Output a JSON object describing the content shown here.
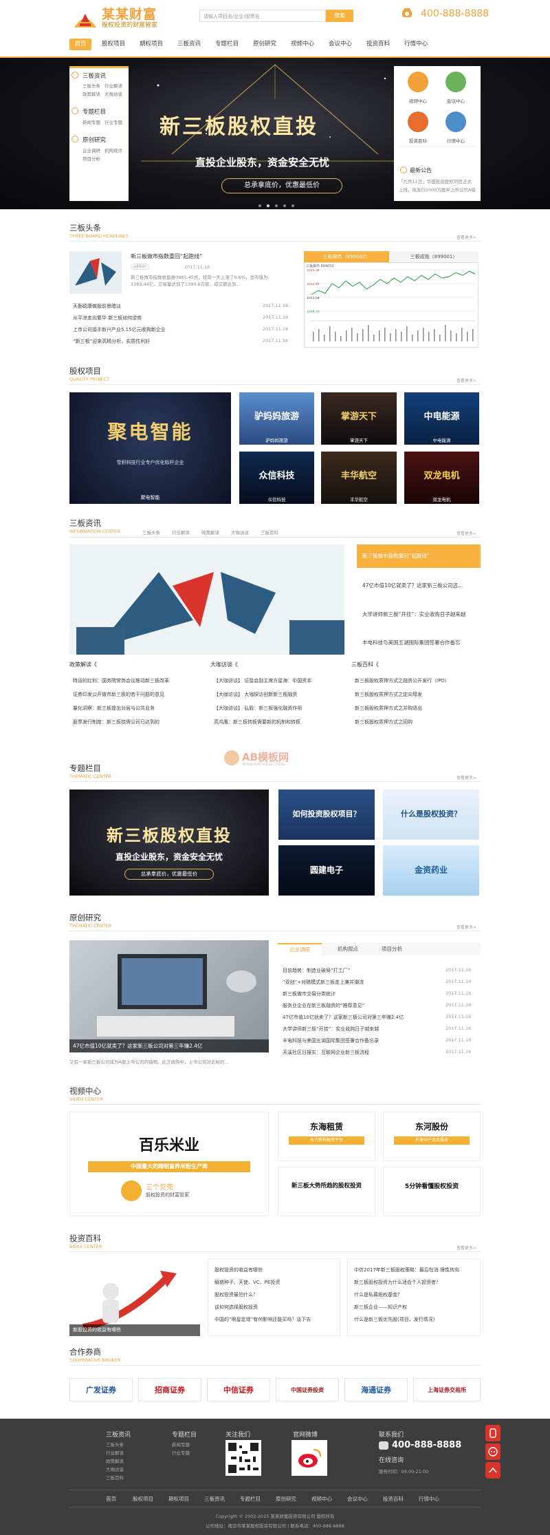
{
  "header": {
    "brand": "某某财富",
    "slogan": "股权投资的财富管家",
    "search_placeholder": "请输入项目名/企业/股票名",
    "search_button": "搜索",
    "phone": "400-888-8888"
  },
  "nav": [
    "首页",
    "股权项目",
    "期权项目",
    "三板资讯",
    "专题栏目",
    "原创研究",
    "视频中心",
    "会议中心",
    "投资百科",
    "行情中心"
  ],
  "banner": {
    "title": "新三板股权直投",
    "subtitle": "直投企业股东，资金安全无忧",
    "pill": "总承拿底价，优惠最低价"
  },
  "left_panel": [
    {
      "head": "三板资讯",
      "links": [
        "三板头条",
        "行业解读",
        "政策解读",
        "大咖访谈"
      ]
    },
    {
      "head": "专题栏目",
      "links": [
        "新闻专题",
        "行业专题"
      ]
    },
    {
      "head": "原创研究",
      "links": [
        "企业调研",
        "机构观点",
        "项目分析"
      ]
    }
  ],
  "right_panel": {
    "icons": [
      {
        "label": "视频中心",
        "color": "#f2a23b"
      },
      {
        "label": "会议中心",
        "color": "#6bb35a"
      },
      {
        "label": "投资百科",
        "color": "#e86e2b"
      },
      {
        "label": "行情中心",
        "color": "#4d8ec9"
      }
    ],
    "notice_title": "最新公告",
    "notice_text": "「九月11日」华盛投资股权项目正式上线，拟发行2000万股并上市公司A级认购"
  },
  "headlines": {
    "title": "三板头条",
    "en": "THREE BOARD HEADLINES",
    "more": "查看更多>",
    "feature": {
      "title": "新三板做市指数重回“起跑线”",
      "tag": "admin",
      "date": "2017.11.16",
      "desc": "新三板做市指数收盘报0985.45点，较前一天上涨了0.6%，总市值为1383.44亿，交易量达到了1390.6万股，成交额达到..."
    },
    "items": [
      {
        "t": "天勤德康做股前景暗淡",
        "d": "2017.11.16"
      },
      {
        "t": "从平凉走向繁华 新三板如何逆势",
        "d": "2017.11.16"
      },
      {
        "t": "上市公司接手新兴产业5.15亿元收购新企业",
        "d": "2017.11.16"
      },
      {
        "t": "“新三板”迎来高精分析，实质性利好",
        "d": "2017.11.16"
      }
    ]
  },
  "market": {
    "tab1": "三板做市（899002）",
    "tab2": "三板成指（899001）",
    "name": "三板做市 899002",
    "values": [
      "1015.34",
      "1013.46",
      "1011.58",
      "1009.70",
      "1007.82"
    ]
  },
  "projects": {
    "title": "股权项目",
    "en": "QUALITY PROJECT",
    "more": "查看更多>",
    "big": {
      "name": "聚电智能",
      "line1": "雪积科技行业专户优化标杆企业",
      "caption": "聚电智能"
    },
    "tiles": [
      {
        "name": "驴妈妈旅游",
        "caption": "驴妈妈旅游"
      },
      {
        "name": "掌游天下",
        "caption": "掌游天下"
      },
      {
        "name": "中电能源",
        "caption": "中电能源"
      },
      {
        "name": "众信科技",
        "caption": "众信科技"
      },
      {
        "name": "丰华航空",
        "caption": "丰华航空"
      },
      {
        "name": "双龙电机",
        "caption": "双龙电机"
      }
    ]
  },
  "news": {
    "title": "三板资讯",
    "en": "INFORMATION CENTER",
    "tabs": [
      "三板头条",
      "行业解读",
      "政策解读",
      "大咖访谈",
      "三板百科"
    ],
    "more": "查看更多>",
    "side": [
      "新三板做市指数重回“起跑线”",
      "47亿市值10亿就卖了？这家新三板公司还...",
      "大学讲师新三板“开挂”：实业收购日子越来越",
      "丰电科技与美国五湖国际集团签署合作备忘"
    ],
    "cols": [
      {
        "head": "政策解读《",
        "items": [
          "特运的红利：国务院常务会议推动新三板改革",
          "证券印发公开做市新三板的若干问题的意见",
          "量化洞察：新三板提出分层与公共业务",
          "股票发行制度：新三板挂牌公司已达到的"
        ]
      },
      {
        "head": "大咖访谈《",
        "items": [
          "【大咖访谈】 证监会副主席方星海：中国资本",
          "【大咖访谈】 大咖探访创新新三板融资",
          "【大咖访谈】 弘毅：新三板强化融资作用",
          "高鸿鹰：新三板转板需要新的机制和转板"
        ]
      },
      {
        "head": "三板百科《",
        "items": [
          "新三板股权质押方式之融资公开发行（IPO）",
          "新三板股权质押方式之定向增发",
          "新三板股权质押方式之并购退出",
          "新三板股权质押方式之回购"
        ]
      }
    ]
  },
  "watermark": {
    "main": "AB模板网",
    "sub": "Www.Admoban.Com"
  },
  "thematic": {
    "title": "专题栏目",
    "en": "THEMATIC CENTER",
    "more": "查看更多>",
    "big": {
      "title": "新三板股权直投",
      "sub": "直投企业股东，资金安全无忧",
      "pill": "总承拿底价，优惠最低价"
    },
    "tiles": [
      "如何投资股权项目？",
      "什么是股权投资？",
      "圆建电子",
      "金资药业"
    ]
  },
  "research": {
    "title": "原创研究",
    "en": "THEMATIC CENTER",
    "more": "查看更多>",
    "caption": "47亿市值10亿就卖了？这家新三板公司对第三年赚2.4亿",
    "desc": "又有一家新三板公司成为A股上市公司的猎物。此次收购中，上市公司对此标的...",
    "tabs": [
      "企业调研",
      "机构观点",
      "项目分析"
    ],
    "items": [
      {
        "t": "目前趋势：制造业破局“打工厂”",
        "d": "2017.11.16"
      },
      {
        "t": "“双创”+对赌模式新三板走上兼并潮流",
        "d": "2017.11.16"
      },
      {
        "t": "新三板做市交易分类统计",
        "d": "2017.11.16"
      },
      {
        "t": "服务业企业在新三板融资的“推荐意见”",
        "d": "2017.11.16"
      },
      {
        "t": "47亿市值10亿就卖了？这家新三板公司对第三年赚2.4亿",
        "d": "2017.11.16"
      },
      {
        "t": "大学讲师新三板“开挂”：实业收购日子越来越",
        "d": "2017.11.16"
      },
      {
        "t": "丰电科技与美国五湖国际集团签署合作备忘录",
        "d": "2017.11.16"
      },
      {
        "t": "天溪社区日报实：互联网企业新三板流程",
        "d": "2017.11.16"
      }
    ]
  },
  "video": {
    "title": "视频中心",
    "en": "VIDEO CENTER",
    "big": {
      "name": "百乐米业",
      "ribbon": "中国最大的精制富养米粉生产商",
      "logo": "三个贝壳",
      "logo_sub": "股权投资的财富管家"
    },
    "tiles": [
      {
        "name": "东海租赁",
        "tag": "东方新科融资平台"
      },
      {
        "name": "东河股份",
        "tag": "开发中产品及服务"
      },
      {
        "name": "新三板大势所趋的股权投资",
        "tag": ""
      },
      {
        "name": "5分钟看懂股权投资",
        "tag": ""
      }
    ]
  },
  "baike": {
    "title": "投资百科",
    "en": "BAIKE CENTER",
    "more": "查看更多>",
    "caption": "新股投资的收益有哪些",
    "col1": [
      "股权投资的收益有哪些",
      "解惑种子、天使、VC、PE投资",
      "股权投资最怕什么？",
      "谈如何选择股权投资",
      "中国的“明星定增”有何影响还能买吗？谈下去"
    ],
    "col2": [
      "中信2017年新三板股权策略：最后在消 理性转向",
      "新三板股权投资为什么适合个人投资者？",
      "什么是私募股权基金？",
      "新三板企业——知识产权",
      "什么是新三板优先股(项目，发行情况)"
    ]
  },
  "brokers": {
    "title": "合作券商",
    "en": "COOPERATIVE BROKER",
    "names": [
      "广发证券",
      "招商证券",
      "中信证券",
      "中国证券投资",
      "海通证券",
      "上海证券交易所"
    ]
  },
  "footer": {
    "cols": [
      {
        "head": "三板资讯",
        "links": [
          "三板头条",
          "行业解读",
          "政策解读",
          "大咖访谈",
          "三板百科"
        ]
      },
      {
        "head": "专题栏目",
        "links": [
          "新闻专题",
          "行业专题"
        ]
      },
      {
        "head": "关注我们",
        "links": []
      },
      {
        "head": "官网微博",
        "links": []
      }
    ],
    "contact_head": "联系我们",
    "phone": "400-888-8888",
    "online": "在线咨询",
    "hours": "服务时间：09:00-21:00",
    "nav": [
      "首页",
      "股权项目",
      "期权项目",
      "三板资讯",
      "专题栏目",
      "原创研究",
      "视频中心",
      "会议中心",
      "投资百科",
      "行情中心"
    ],
    "copyright": "Copyright © 2002-2015 某某财富投资有限公司 版权所有",
    "address": "公司地址：南京市某某股权投资有限公司  |  联系电话：400-888-8888"
  }
}
